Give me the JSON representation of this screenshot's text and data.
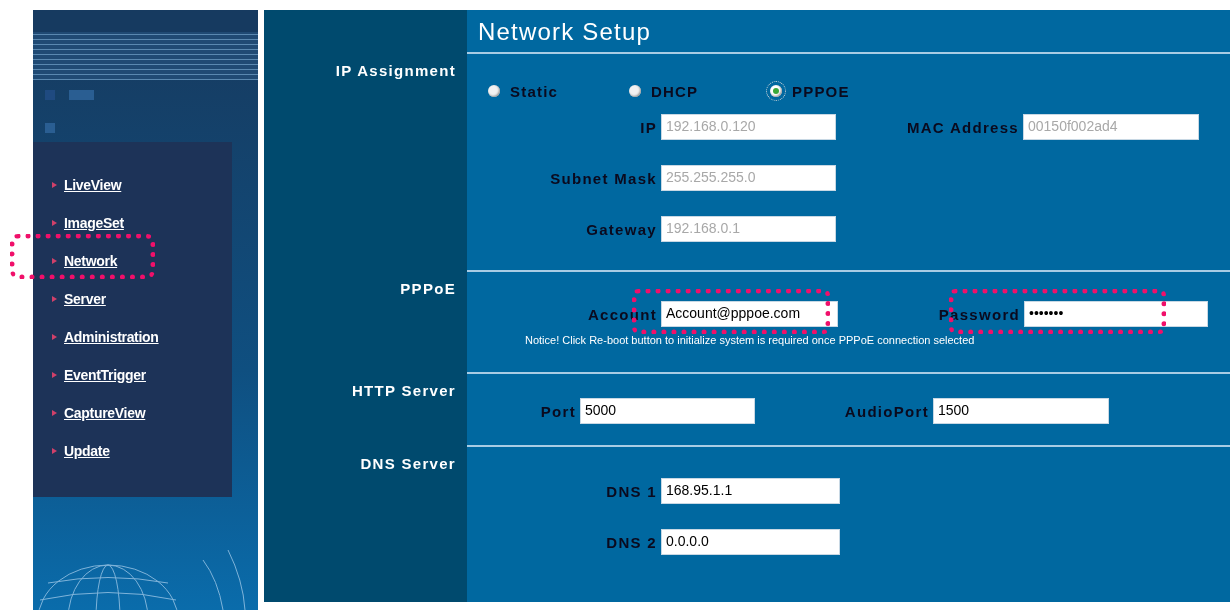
{
  "sidebar": {
    "nav_items": [
      {
        "label": "LiveView",
        "highlighted": false
      },
      {
        "label": "ImageSet",
        "highlighted": false
      },
      {
        "label": "Network",
        "highlighted": true
      },
      {
        "label": "Server",
        "highlighted": false
      },
      {
        "label": "Administration",
        "highlighted": false
      },
      {
        "label": "EventTrigger",
        "highlighted": false
      },
      {
        "label": "CaptureView",
        "highlighted": false
      },
      {
        "label": "Update",
        "highlighted": false
      }
    ]
  },
  "page": {
    "title": "Network Setup"
  },
  "sections": [
    {
      "kind": "ip",
      "heading": "IP Assignment",
      "modes": [
        {
          "label": "Static",
          "selected": false
        },
        {
          "label": "DHCP",
          "selected": false
        },
        {
          "label": "PPPOE",
          "selected": true
        }
      ],
      "rows": [
        [
          {
            "label": "IP",
            "value": "192.168.0.120",
            "disabled": true,
            "highlighted": false
          },
          {
            "label": "MAC Address",
            "value": "00150f002ad4",
            "disabled": true,
            "highlighted": false
          }
        ],
        [
          {
            "label": "Subnet Mask",
            "value": "255.255.255.0",
            "disabled": true,
            "highlighted": false
          }
        ],
        [
          {
            "label": "Gateway",
            "value": "192.168.0.1",
            "disabled": true,
            "highlighted": false
          }
        ]
      ]
    },
    {
      "kind": "pppoe",
      "heading": "PPPoE",
      "rows": [
        [
          {
            "label": "Account",
            "value": "Account@pppoe.com",
            "disabled": false,
            "highlighted": true
          },
          {
            "label": "Password",
            "value": "•••••••",
            "disabled": false,
            "highlighted": true
          }
        ]
      ],
      "notice": "Notice! Click Re-boot button to initialize system is required once PPPoE connection selected"
    },
    {
      "kind": "http",
      "heading": "HTTP Server",
      "rows": [
        [
          {
            "label": "Port",
            "value": "5000",
            "disabled": false,
            "highlighted": false
          },
          {
            "label": "AudioPort",
            "value": "1500",
            "disabled": false,
            "highlighted": false
          }
        ]
      ]
    },
    {
      "kind": "dns",
      "heading": "DNS Server",
      "rows": [
        [
          {
            "label": "DNS 1",
            "value": "168.95.1.1",
            "disabled": false,
            "highlighted": false
          }
        ],
        [
          {
            "label": "DNS 2",
            "value": "0.0.0.0",
            "disabled": false,
            "highlighted": false
          }
        ]
      ]
    }
  ]
}
